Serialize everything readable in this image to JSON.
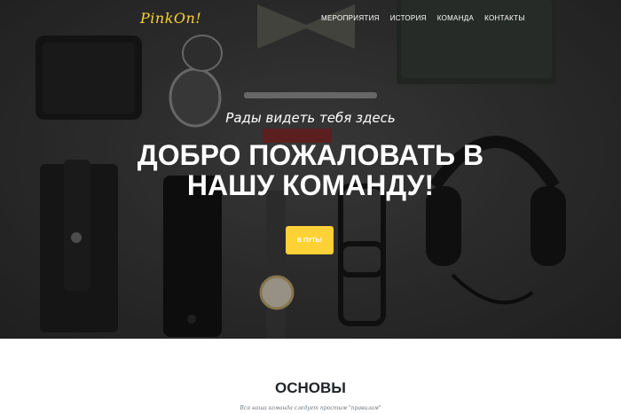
{
  "brand": {
    "logo": "PinkOn!",
    "accent": "#fed136"
  },
  "nav": {
    "items": [
      {
        "label": "МЕРОПРИЯТИЯ"
      },
      {
        "label": "ИСТОРИЯ"
      },
      {
        "label": "КОМАНДА"
      },
      {
        "label": "КОНТАКТЫ"
      }
    ]
  },
  "hero": {
    "subheading": "Рады видеть тебя здесь",
    "heading": "ДОБРО ПОЖАЛОВАТЬ В НАШУ КОМАНДУ!",
    "button": "В ПУТЬ!"
  },
  "section": {
    "title": "ОСНОВЫ",
    "subtitle": "Вся наша команда следует простым \"правилам\""
  }
}
